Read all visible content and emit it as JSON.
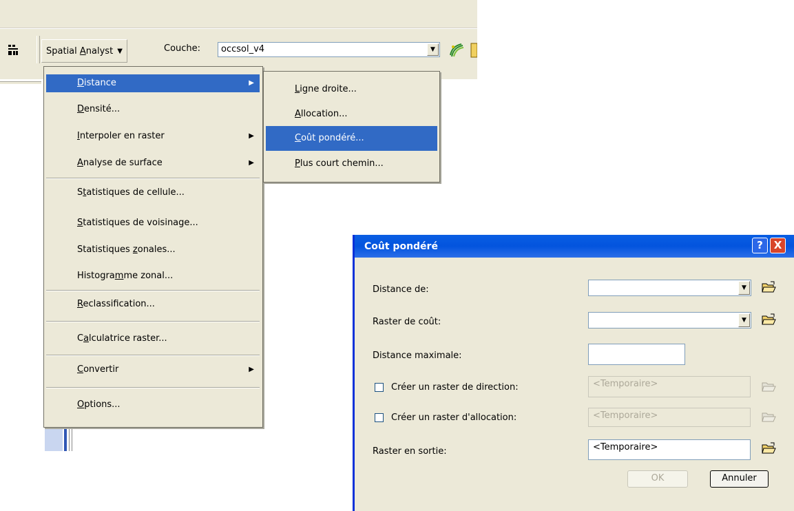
{
  "toolbar": {
    "spatial_analyst_prefix": "Spatial ",
    "spatial_analyst_accel": "A",
    "spatial_analyst_rest": "nalyst",
    "couche_label": "Couche:",
    "couche_value": "occsol_v4"
  },
  "menu": {
    "items": [
      {
        "pre": "",
        "accel": "D",
        "post": "istance"
      },
      {
        "pre": "",
        "accel": "D",
        "post": "ensité..."
      },
      {
        "pre": "",
        "accel": "I",
        "post": "nterpoler en raster"
      },
      {
        "pre": "",
        "accel": "A",
        "post": "nalyse de surface"
      },
      {
        "pre": "S",
        "accel": "t",
        "post": "atistiques de cellule..."
      },
      {
        "pre": "",
        "accel": "S",
        "post": "tatistiques de voisinage..."
      },
      {
        "pre": "Statistiques ",
        "accel": "z",
        "post": "onales..."
      },
      {
        "pre": "Histogra",
        "accel": "m",
        "post": "me zonal..."
      },
      {
        "pre": "",
        "accel": "R",
        "post": "eclassification..."
      },
      {
        "pre": "C",
        "accel": "a",
        "post": "lculatrice raster..."
      },
      {
        "pre": "",
        "accel": "C",
        "post": "onvertir"
      },
      {
        "pre": "",
        "accel": "O",
        "post": "ptions..."
      }
    ]
  },
  "submenu": {
    "items": [
      {
        "pre": "",
        "accel": "L",
        "post": "igne droite..."
      },
      {
        "pre": "",
        "accel": "A",
        "post": "llocation..."
      },
      {
        "pre": "",
        "accel": "C",
        "post": "oût pondéré..."
      },
      {
        "pre": "",
        "accel": "P",
        "post": "lus court chemin..."
      }
    ]
  },
  "dialog": {
    "title": "Coût pondéré",
    "help": "?",
    "close": "X",
    "distance_de_label": "Distance de:",
    "raster_cout_label": "Raster de coût:",
    "distance_max_label": "Distance maximale:",
    "creer_direction_label": "Créer un raster de direction:",
    "creer_direction_value": "<Temporaire>",
    "creer_allocation_label": "Créer un raster d'allocation:",
    "creer_allocation_value": "<Temporaire>",
    "raster_sortie_label": "Raster en sortie:",
    "raster_sortie_value": "<Temporaire>",
    "ok": "OK",
    "annuler": "Annuler"
  }
}
